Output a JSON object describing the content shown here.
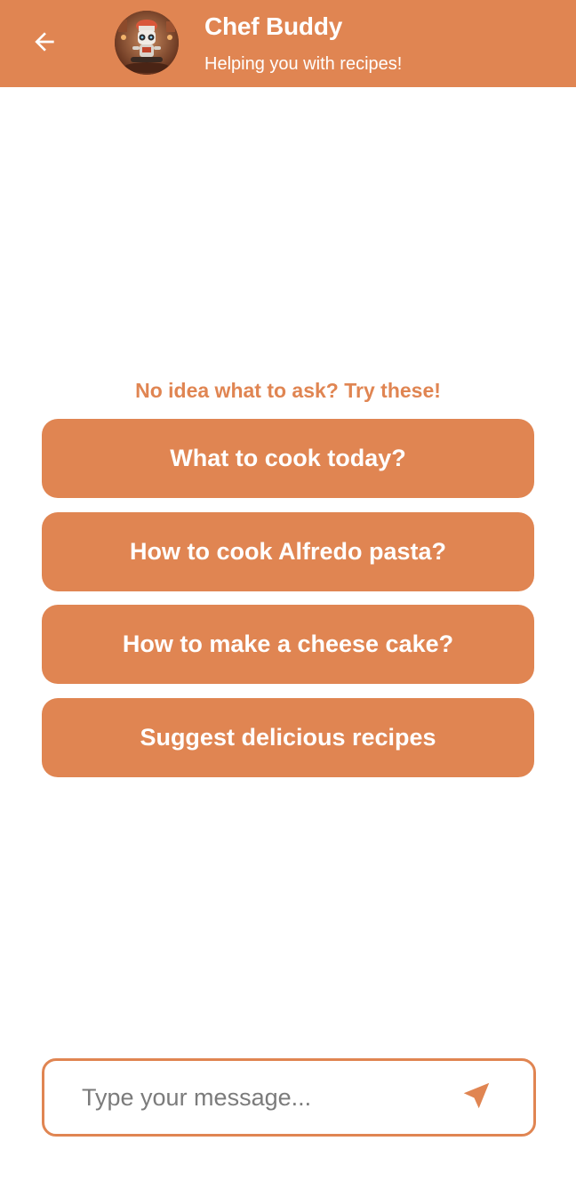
{
  "header": {
    "back_icon": "arrow-left-icon",
    "avatar_icon": "chef-robot-avatar",
    "title": "Chef Buddy",
    "subtitle": "Helping you with recipes!"
  },
  "prompt": {
    "text": "No idea what to ask? Try these!"
  },
  "suggestions": [
    {
      "label": "What to cook today?"
    },
    {
      "label": "How to cook Alfredo pasta?"
    },
    {
      "label": "How to make a cheese cake?"
    },
    {
      "label": "Suggest delicious recipes"
    }
  ],
  "composer": {
    "placeholder": "Type your message...",
    "value": "",
    "send_icon": "send-icon"
  },
  "colors": {
    "accent": "#E08552",
    "on_accent": "#FFFFFF",
    "background": "#FFFFFF",
    "placeholder": "#7B7B7B"
  }
}
